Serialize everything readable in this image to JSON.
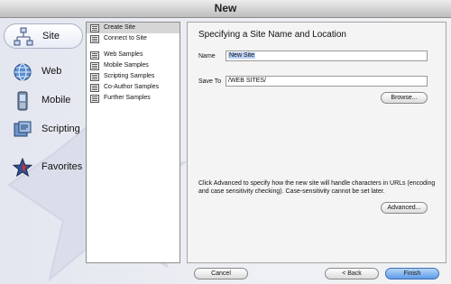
{
  "window": {
    "title": "New"
  },
  "categories": [
    {
      "label": "Site",
      "icon": "site-icon",
      "selected": true
    },
    {
      "label": "Web",
      "icon": "globe-icon",
      "selected": false
    },
    {
      "label": "Mobile",
      "icon": "mobile-phone-icon",
      "selected": false
    },
    {
      "label": "Scripting",
      "icon": "scripting-icon",
      "selected": false
    },
    {
      "label": "Favorites",
      "icon": "star-icon",
      "selected": false
    }
  ],
  "templates": {
    "site_items": [
      "Create Site",
      "Connect to Site"
    ],
    "sample_items": [
      "Web Samples",
      "Mobile Samples",
      "Scripting Samples",
      "Co-Author Samples",
      "Further Samples"
    ]
  },
  "panel": {
    "heading": "Specifying a Site Name and Location",
    "name_label": "Name",
    "name_value": "New Site",
    "save_to_label": "Save To",
    "save_to_value": "/WEB SITES/",
    "browse_button": "Browse...",
    "advanced_info": "Click Advanced to specify how the new site will handle characters in URLs (encoding and case sensitivity checking). Case-sensitivity cannot be set later.",
    "advanced_button": "Advanced..."
  },
  "footer": {
    "cancel": "Cancel",
    "back": "< Back",
    "finish": "Finish"
  }
}
